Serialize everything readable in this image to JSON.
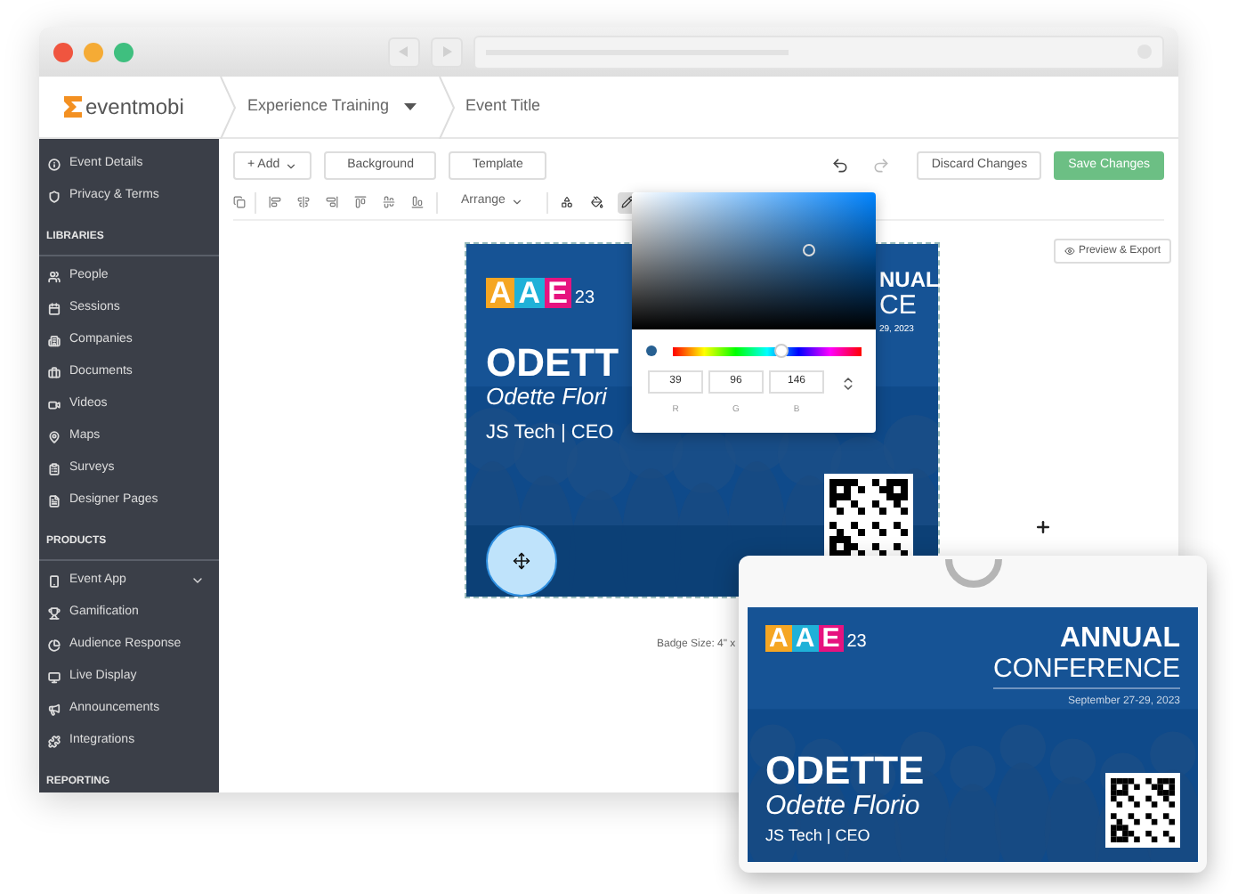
{
  "app": {
    "logo": "eventmobi",
    "breadcrumbs": [
      {
        "label": "Experience Training",
        "dropdown": true
      },
      {
        "label": "Event Title",
        "dropdown": false
      }
    ]
  },
  "sidebar": {
    "sections": [
      {
        "items": [
          {
            "label": "Event Details"
          },
          {
            "label": "Privacy & Terms"
          }
        ]
      },
      {
        "heading": "LIBRARIES",
        "items": [
          {
            "label": "People"
          },
          {
            "label": "Sessions"
          },
          {
            "label": "Companies"
          },
          {
            "label": "Documents"
          },
          {
            "label": "Videos"
          },
          {
            "label": "Maps"
          },
          {
            "label": "Surveys"
          },
          {
            "label": "Designer Pages"
          }
        ]
      },
      {
        "heading": "PRODUCTS",
        "items": [
          {
            "label": "Event App",
            "expanded": false
          },
          {
            "label": "Gamification"
          },
          {
            "label": "Audience Response"
          },
          {
            "label": "Live Display"
          },
          {
            "label": "Announcements"
          },
          {
            "label": "Integrations"
          }
        ]
      },
      {
        "heading": "REPORTING"
      }
    ]
  },
  "toolbar": {
    "add": "+ Add",
    "buttons": [
      "Background",
      "Template"
    ],
    "discard": "Discard Changes",
    "save": "Save Changes",
    "arrange": "Arrange",
    "format_tools": [
      {
        "selected": false
      },
      {
        "selected": false
      },
      {
        "selected": true
      }
    ]
  },
  "canvas": {
    "preview_button": "Preview & Export",
    "badge_size": "Badge Size: 4\" x",
    "badge": {
      "logo": {
        "letters": [
          {
            "text": "A",
            "color": "#f5a623"
          },
          {
            "text": "A",
            "color": "#1fb1d8"
          },
          {
            "text": "E",
            "color": "#e6137f"
          }
        ],
        "suffix": "23"
      },
      "title_parts": [
        "NUAL",
        "CE"
      ],
      "date": "29, 2023",
      "first_name": "ODETT",
      "full_name": "Odette Flori",
      "role": "JS Tech | CEO"
    }
  },
  "color_picker": {
    "color": "#276092",
    "hue_slider": {
      "level": 0.58
    },
    "channels": [
      {
        "label": "R",
        "value": "39"
      },
      {
        "label": "G",
        "value": "96"
      },
      {
        "label": "B",
        "value": "146"
      }
    ]
  },
  "badge_preview": {
    "logo": {
      "letters": [
        {
          "text": "A",
          "color": "#f5a623"
        },
        {
          "text": "A",
          "color": "#1fb1d8"
        },
        {
          "text": "E",
          "color": "#e6137f"
        }
      ],
      "suffix": "23"
    },
    "title": [
      "ANNUAL",
      "CONFERENCE"
    ],
    "date": "September 27-29, 2023",
    "first_name": "ODETTE",
    "full_name": "Odette Florio",
    "role": "JS Tech | CEO"
  }
}
